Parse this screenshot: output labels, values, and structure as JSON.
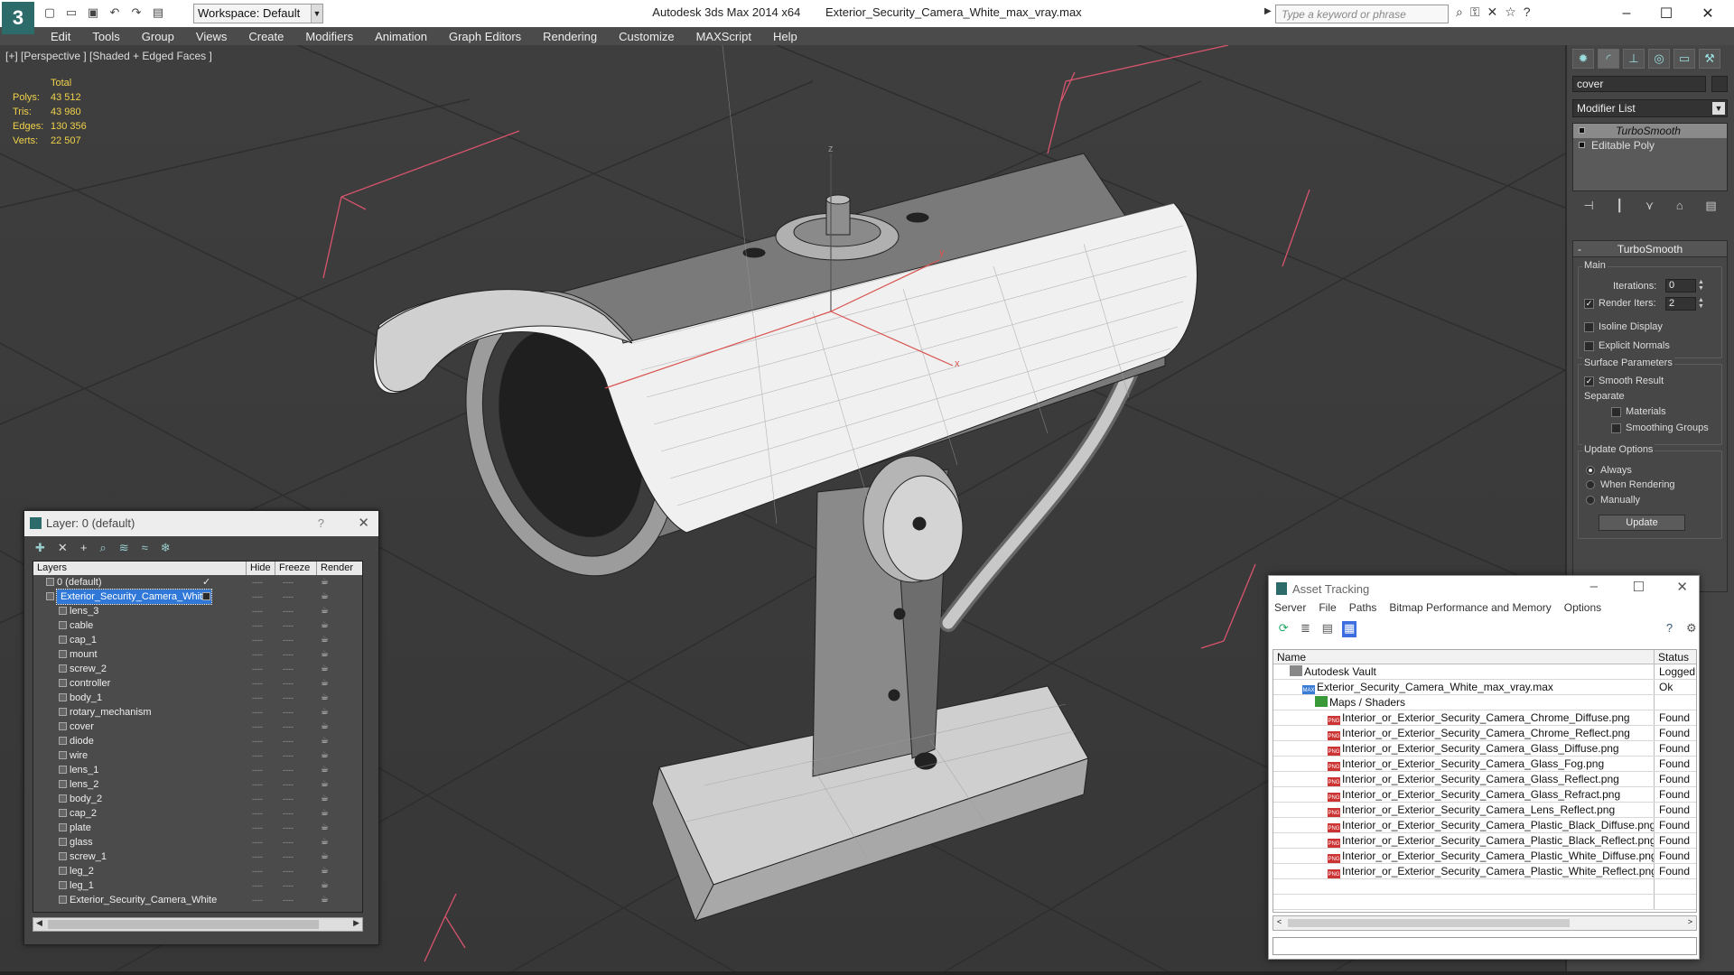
{
  "app": {
    "icon_letter": "3",
    "title": "Autodesk 3ds Max  2014 x64",
    "file": "Exterior_Security_Camera_White_max_vray.max",
    "workspace": "Workspace: Default",
    "search_placeholder": "Type a keyword or phrase"
  },
  "menu": [
    "Edit",
    "Tools",
    "Group",
    "Views",
    "Create",
    "Modifiers",
    "Animation",
    "Graph Editors",
    "Rendering",
    "Customize",
    "MAXScript",
    "Help"
  ],
  "viewport": {
    "label": "[+] [Perspective ] [Shaded + Edged Faces ]",
    "stats_header": "Total",
    "stats": [
      {
        "k": "Polys:",
        "v": "43 512"
      },
      {
        "k": "Tris:",
        "v": "43 980"
      },
      {
        "k": "Edges:",
        "v": "130 356"
      },
      {
        "k": "Verts:",
        "v": "22 507"
      }
    ],
    "axis": {
      "x": "x",
      "y": "y",
      "z": "z"
    }
  },
  "command_panel": {
    "object_name": "cover",
    "modifier_list": "Modifier List",
    "stack": [
      "TurboSmooth",
      "Editable Poly"
    ],
    "rollout_title": "TurboSmooth",
    "main_label": "Main",
    "iterations_label": "Iterations:",
    "iterations_value": "0",
    "render_iters_label": "Render Iters:",
    "render_iters_value": "2",
    "isoline": "Isoline Display",
    "explicit_normals": "Explicit Normals",
    "surface_params": "Surface Parameters",
    "smooth_result": "Smooth Result",
    "separate": "Separate",
    "materials": "Materials",
    "smoothing_groups": "Smoothing Groups",
    "update_options": "Update Options",
    "always": "Always",
    "when_rendering": "When Rendering",
    "manually": "Manually",
    "update_button": "Update"
  },
  "layer_window": {
    "title": "Layer: 0 (default)",
    "help": "?",
    "columns": [
      "Layers",
      "Hide",
      "Freeze",
      "Render"
    ],
    "rows": [
      {
        "name": "0 (default)",
        "level": 1
      },
      {
        "name": "Exterior_Security_Camera_White",
        "level": 1,
        "selected": true
      },
      {
        "name": "lens_3",
        "level": 2
      },
      {
        "name": "cable",
        "level": 2
      },
      {
        "name": "cap_1",
        "level": 2
      },
      {
        "name": "mount",
        "level": 2
      },
      {
        "name": "screw_2",
        "level": 2
      },
      {
        "name": "controller",
        "level": 2
      },
      {
        "name": "body_1",
        "level": 2
      },
      {
        "name": "rotary_mechanism",
        "level": 2
      },
      {
        "name": "cover",
        "level": 2
      },
      {
        "name": "diode",
        "level": 2
      },
      {
        "name": "wire",
        "level": 2
      },
      {
        "name": "lens_1",
        "level": 2
      },
      {
        "name": "lens_2",
        "level": 2
      },
      {
        "name": "body_2",
        "level": 2
      },
      {
        "name": "cap_2",
        "level": 2
      },
      {
        "name": "plate",
        "level": 2
      },
      {
        "name": "glass",
        "level": 2
      },
      {
        "name": "screw_1",
        "level": 2
      },
      {
        "name": "leg_2",
        "level": 2
      },
      {
        "name": "leg_1",
        "level": 2
      },
      {
        "name": "Exterior_Security_Camera_White",
        "level": 2
      }
    ],
    "dash": "----"
  },
  "asset_tracking": {
    "title": "Asset Tracking",
    "menu": [
      "Server",
      "File",
      "Paths",
      "Bitmap Performance and Memory",
      "Options"
    ],
    "columns": [
      "Name",
      "Status"
    ],
    "rows": [
      {
        "name": "Autodesk Vault",
        "status": "Logged",
        "level": 0,
        "kind": "vault"
      },
      {
        "name": "Exterior_Security_Camera_White_max_vray.max",
        "status": "Ok",
        "level": 1,
        "kind": "max"
      },
      {
        "name": "Maps / Shaders",
        "status": "",
        "level": 2,
        "kind": "folder"
      },
      {
        "name": "Interior_or_Exterior_Security_Camera_Chrome_Diffuse.png",
        "status": "Found",
        "level": 3,
        "kind": "png"
      },
      {
        "name": "Interior_or_Exterior_Security_Camera_Chrome_Reflect.png",
        "status": "Found",
        "level": 3,
        "kind": "png"
      },
      {
        "name": "Interior_or_Exterior_Security_Camera_Glass_Diffuse.png",
        "status": "Found",
        "level": 3,
        "kind": "png"
      },
      {
        "name": "Interior_or_Exterior_Security_Camera_Glass_Fog.png",
        "status": "Found",
        "level": 3,
        "kind": "png"
      },
      {
        "name": "Interior_or_Exterior_Security_Camera_Glass_Reflect.png",
        "status": "Found",
        "level": 3,
        "kind": "png"
      },
      {
        "name": "Interior_or_Exterior_Security_Camera_Glass_Refract.png",
        "status": "Found",
        "level": 3,
        "kind": "png"
      },
      {
        "name": "Interior_or_Exterior_Security_Camera_Lens_Reflect.png",
        "status": "Found",
        "level": 3,
        "kind": "png"
      },
      {
        "name": "Interior_or_Exterior_Security_Camera_Plastic_Black_Diffuse.png",
        "status": "Found",
        "level": 3,
        "kind": "png"
      },
      {
        "name": "Interior_or_Exterior_Security_Camera_Plastic_Black_Reflect.png",
        "status": "Found",
        "level": 3,
        "kind": "png"
      },
      {
        "name": "Interior_or_Exterior_Security_Camera_Plastic_White_Diffuse.png",
        "status": "Found",
        "level": 3,
        "kind": "png"
      },
      {
        "name": "Interior_or_Exterior_Security_Camera_Plastic_White_Reflect.png",
        "status": "Found",
        "level": 3,
        "kind": "png"
      }
    ]
  },
  "colors": {
    "accent": "#2f78d8",
    "stats": "#f1d24a",
    "gizmo": "#d9534f",
    "bbox": "#e0607a"
  }
}
